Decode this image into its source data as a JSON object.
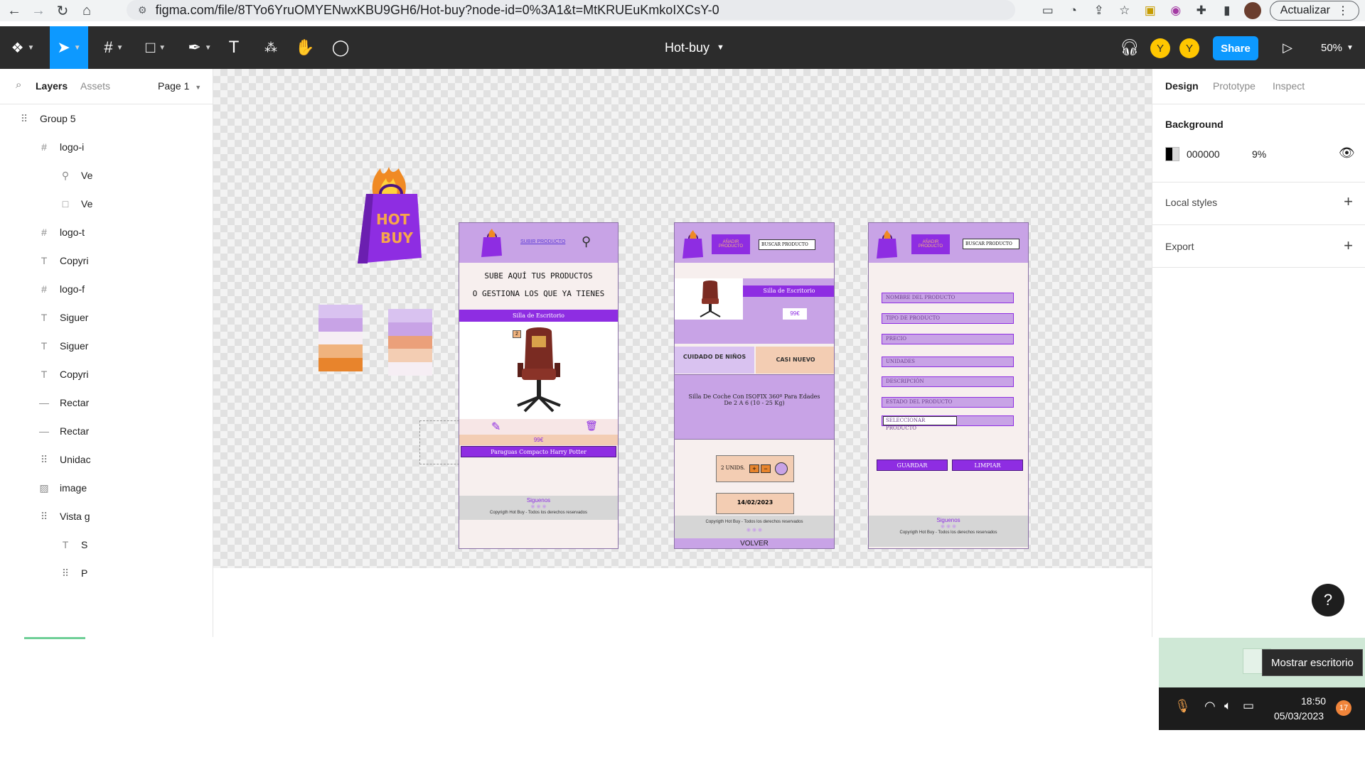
{
  "browser": {
    "url": "figma.com/file/8TYo6YruOMYENwxKBU9GH6/Hot-buy?node-id=0%3A1&t=MtKRUEuKmkoIXCsY-0",
    "update_label": "Actualizar"
  },
  "toolbar": {
    "file_title": "Hot-buy",
    "avatars": [
      "Y",
      "Y"
    ],
    "share_label": "Share",
    "zoom": "50%"
  },
  "left_panel": {
    "tabs": [
      "Layers",
      "Assets"
    ],
    "page_label": "Page 1",
    "layers": [
      {
        "icon": "group-icon",
        "glyph": "⠿",
        "label": "Group 5"
      },
      {
        "icon": "frame-icon",
        "glyph": "#",
        "label": "logo-i"
      },
      {
        "icon": "vector-icon",
        "glyph": "⚲",
        "label": "Ve"
      },
      {
        "icon": "rectangle-icon",
        "glyph": "□",
        "label": "Ve"
      },
      {
        "icon": "frame-icon",
        "glyph": "#",
        "label": "logo-t"
      },
      {
        "icon": "text-icon",
        "glyph": "T",
        "label": "Copyri"
      },
      {
        "icon": "frame-icon",
        "glyph": "#",
        "label": "logo-f"
      },
      {
        "icon": "text-icon",
        "glyph": "T",
        "label": "Siguer"
      },
      {
        "icon": "text-icon",
        "glyph": "T",
        "label": "Siguer"
      },
      {
        "icon": "text-icon",
        "glyph": "T",
        "label": "Copyri"
      },
      {
        "icon": "line-icon",
        "glyph": "—",
        "label": "Rectar"
      },
      {
        "icon": "line-icon",
        "glyph": "—",
        "label": "Rectar"
      },
      {
        "icon": "group-icon",
        "glyph": "⠿",
        "label": "Unidac"
      },
      {
        "icon": "image-icon",
        "glyph": "▨",
        "label": "image"
      },
      {
        "icon": "group-icon",
        "glyph": "⠿",
        "label": "Vista g"
      },
      {
        "icon": "text-icon",
        "glyph": "T",
        "label": "S"
      },
      {
        "icon": "group-icon",
        "glyph": "⠿",
        "label": "P"
      }
    ]
  },
  "right_panel": {
    "tabs": [
      "Design",
      "Prototype",
      "Inspect"
    ],
    "background_label": "Background",
    "background_hex": "000000",
    "background_opacity": "9%",
    "local_styles_label": "Local styles",
    "export_label": "Export"
  },
  "canvas": {
    "logo_text_top": "HOT",
    "logo_text_bottom": "BUY",
    "screen1": {
      "link_text": "SUBIR PRODUCTO",
      "headline_1": "SUBE AQUÍ TUS PRODUCTOS",
      "headline_2": "O GESTIONA LOS QUE YA TIENES",
      "product_1": "Silla de Escritorio",
      "qty_badge": "2",
      "price": "99€",
      "product_2": "Paraguas Compacto Harry Potter",
      "footer_follow": "Siguenos",
      "footer_copy": "Copyrigth Hot Buy - Todos los derechos reservados"
    },
    "screen2": {
      "add_button": "AÑADIR PRODUCTO",
      "search_placeholder": "BUSCAR PRODUCTO",
      "product_name": "Silla de Escritorio",
      "price": "99€",
      "tag_1": "CUIDADO DE NIÑOS",
      "tag_2": "CASI NUEVO",
      "description": "Silla De Coche Con ISOFIX 360º Para Edades De 2 A 6 (10 - 25 Kg)",
      "units_label": "2 UNIDS.",
      "date": "14/02/2023",
      "footer_copy": "Copyrigth Hot Buy - Todos los derechos reservados",
      "back_label": "VOLVER"
    },
    "screen3": {
      "add_button": "AÑADIR PRODUCTO",
      "search_placeholder": "BUSCAR PRODUCTO",
      "fields": [
        "NOMBRE DEL PRODUCTO",
        "TIPO DE PRODUCTO",
        "PRECIO",
        "UNIDADES",
        "DESCRIPCIÓN",
        "ESTADO DEL PRODUCTO",
        "SELECCIONAR PRODUCTO"
      ],
      "save_label": "GUARDAR",
      "clear_label": "LIMPIAR",
      "footer_follow": "Siguenos",
      "footer_copy": "Copyrigth Hot Buy - Todos los derechos reservados"
    }
  },
  "overlay": {
    "help_label": "?",
    "tooltip": "Mostrar escritorio",
    "time": "18:50",
    "date": "05/03/2023",
    "notification_count": "17"
  },
  "colors": {
    "figma_dark": "#2c2c2c",
    "figma_blue": "#0d99ff",
    "brand_purple": "#8e2de2",
    "brand_lilac": "#c8a3e6",
    "brand_orange": "#e8842c"
  }
}
